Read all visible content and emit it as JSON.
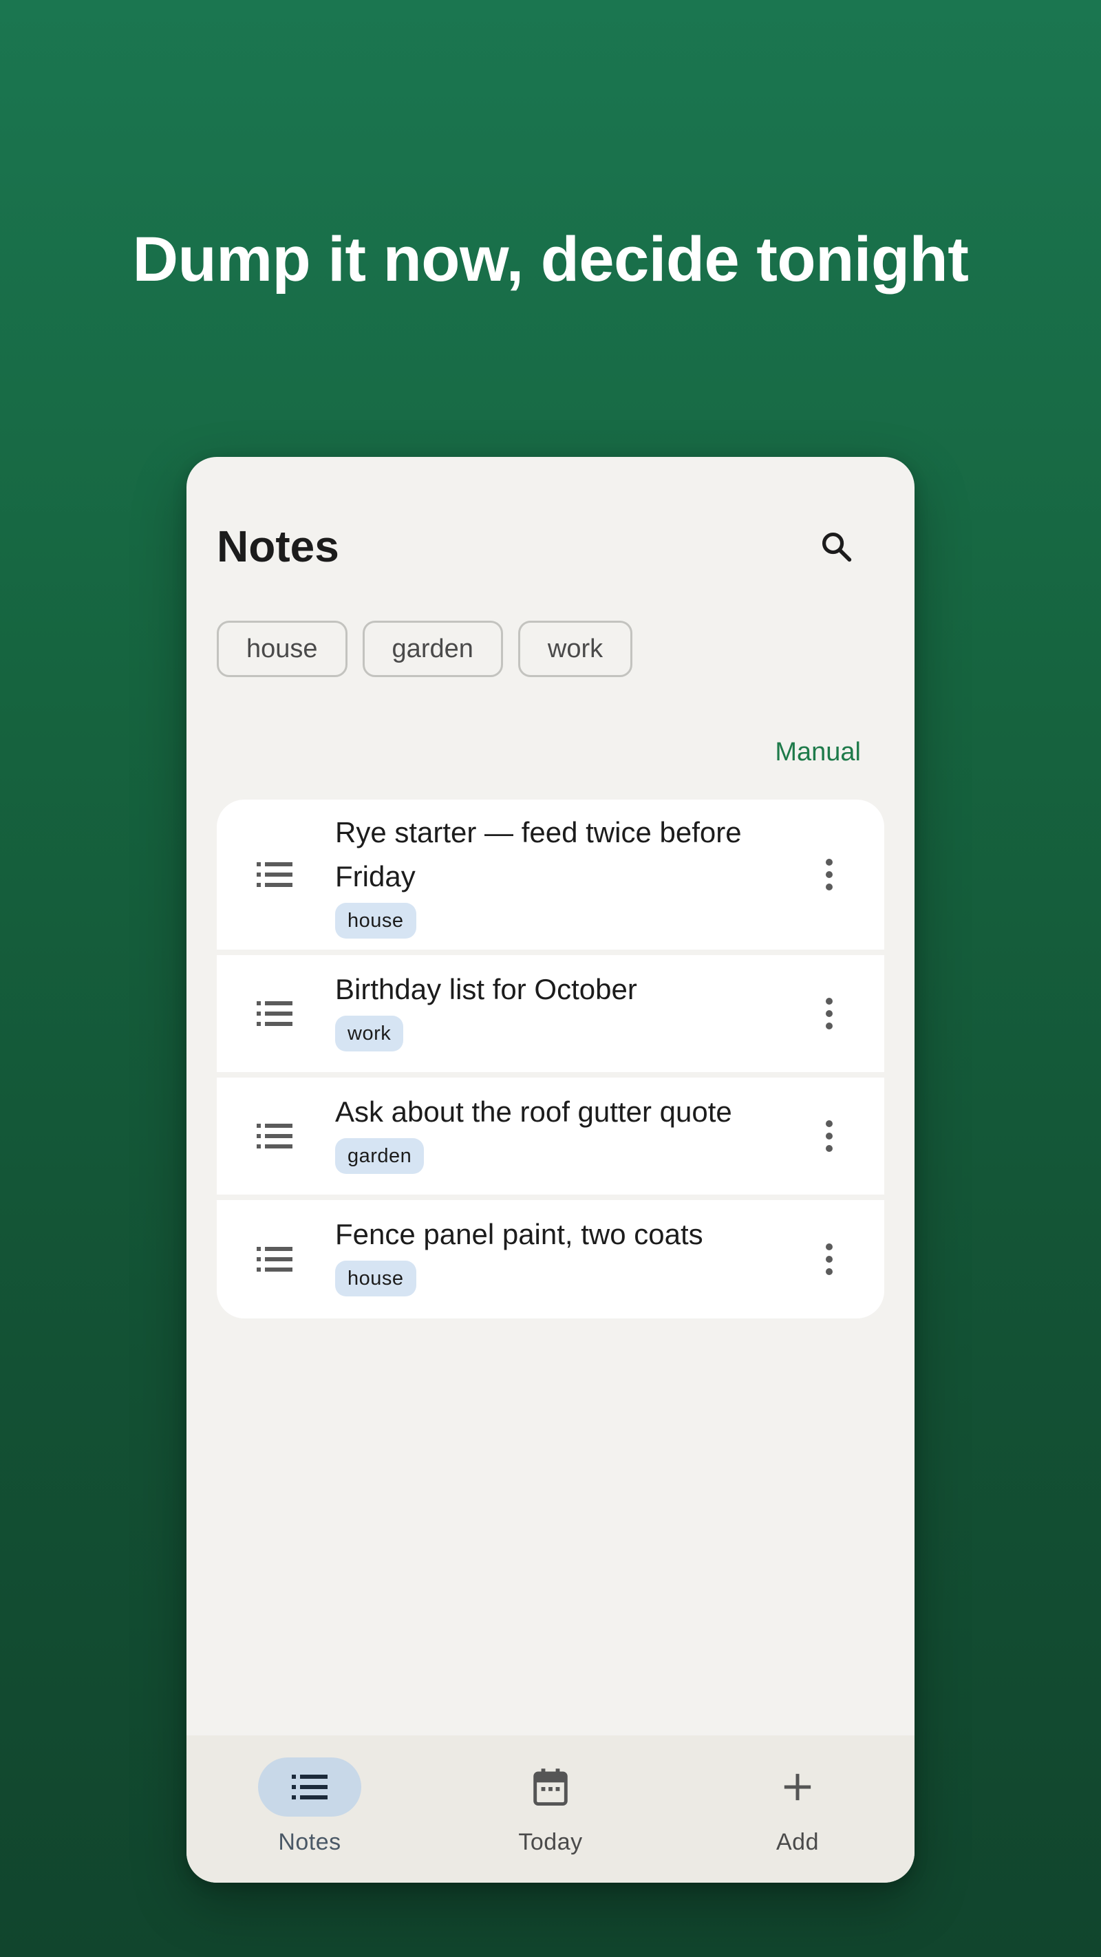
{
  "headline": "Dump it now, decide tonight",
  "app": {
    "title": "Notes",
    "search_icon": "search-icon"
  },
  "filters": [
    "house",
    "garden",
    "work"
  ],
  "sort": {
    "label": "Manual"
  },
  "notes": [
    {
      "title": "Rye starter — feed twice before Friday",
      "tag": "house"
    },
    {
      "title": "Birthday list for October",
      "tag": "work"
    },
    {
      "title": "Ask about the roof gutter quote",
      "tag": "garden"
    },
    {
      "title": "Fence panel paint, two coats",
      "tag": "house"
    }
  ],
  "bottom_nav": {
    "items": [
      {
        "label": "Notes",
        "icon": "list-icon",
        "active": true
      },
      {
        "label": "Today",
        "icon": "calendar-icon",
        "active": false
      },
      {
        "label": "Add",
        "icon": "plus-icon",
        "active": false
      }
    ]
  },
  "colors": {
    "background_top": "#1b7650",
    "background_bottom": "#11452d",
    "accent": "#1e7a4a",
    "tag_bg": "#d6e4f3",
    "active_nav_bg": "#c8d8e8"
  }
}
